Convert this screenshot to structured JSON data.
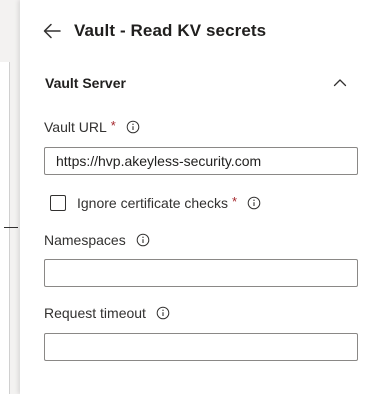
{
  "panel": {
    "title": "Vault - Read KV secrets"
  },
  "section": {
    "title": "Vault Server",
    "expanded": true
  },
  "fields": {
    "vault_url": {
      "label": "Vault URL",
      "required_marker": "*",
      "value": "https://hvp.akeyless-security.com"
    },
    "ignore_cert": {
      "label": "Ignore certificate checks",
      "required_marker": "*",
      "checked": false
    },
    "namespaces": {
      "label": "Namespaces",
      "value": ""
    },
    "request_timeout": {
      "label": "Request timeout",
      "value": ""
    }
  },
  "icons": {
    "back": "arrow-left-icon",
    "collapse": "chevron-up-icon",
    "info": "info-icon"
  }
}
